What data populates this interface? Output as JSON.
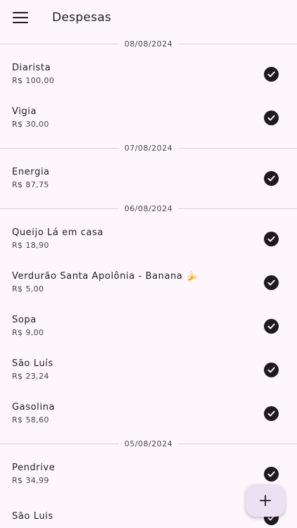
{
  "appbar": {
    "title": "Despesas",
    "menu_icon": "menu-icon"
  },
  "groups": [
    {
      "date": "08/08/2024",
      "items": [
        {
          "name": "Diarista",
          "price": "R$ 100,00"
        },
        {
          "name": "Vigia",
          "price": "R$ 30,00"
        }
      ]
    },
    {
      "date": "07/08/2024",
      "items": [
        {
          "name": "Energia",
          "price": "R$ 87,75"
        }
      ]
    },
    {
      "date": "06/08/2024",
      "items": [
        {
          "name": "Queijo Lá em casa",
          "price": "R$ 18,90"
        },
        {
          "name": "Verdurão Santa Apolônia - Banana 🍌",
          "price": "R$ 5,00"
        },
        {
          "name": "Sopa",
          "price": "R$ 9,00"
        },
        {
          "name": "São Luís",
          "price": "R$ 23,24"
        },
        {
          "name": "Gasolina",
          "price": "R$ 58,60"
        }
      ]
    },
    {
      "date": "05/08/2024",
      "items": [
        {
          "name": "Pendrive",
          "price": "R$ 34,99"
        },
        {
          "name": "São Luis",
          "price": ""
        }
      ]
    }
  ],
  "fab": {
    "icon": "plus-icon"
  },
  "colors": {
    "background": "#fdf7fd",
    "fab": "#ece0f5",
    "text": "#1d1b20"
  }
}
